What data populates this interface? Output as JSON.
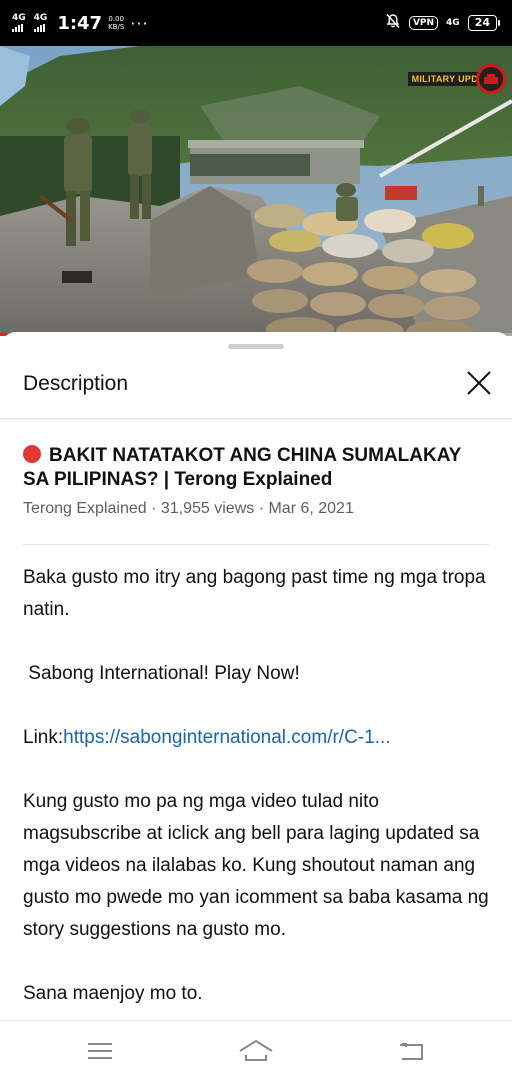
{
  "status_bar": {
    "signal1": "4G",
    "signal2": "4G",
    "time": "1:47",
    "speed_value": "0.00",
    "speed_unit": "KB/S",
    "more": "···",
    "vpn": "VPN",
    "network": "4G",
    "battery": "24"
  },
  "video": {
    "badge_text": "MILITARY UPD",
    "progress_fraction": 0.09,
    "accent_color": "#e62117"
  },
  "sheet": {
    "title": "Description",
    "video_title": "BAKIT NATATAKOT ANG CHINA SUMALAKAY SA PILIPINAS? | Terong Explained",
    "meta": "Terong Explained · 31,955 views · Mar 6, 2021",
    "description": {
      "line1": "Baka gusto mo itry ang bagong past time ng mga tropa natin.",
      "line2": " Sabong International! Play Now!",
      "link_label": "Link:",
      "link_url": "https://sabonginternational.com/r/C-1...",
      "line3": "Kung gusto mo pa ng mga video tulad nito magsubscribe at iclick ang bell para laging updated sa mga videos na ilalabas ko. Kung shoutout naman ang gusto mo pwede mo yan icomment sa baba kasama ng story suggestions na gusto mo.",
      "line4": "Sana maenjoy mo to."
    }
  },
  "icons": {
    "close": "close-icon",
    "menu": "menu-icon",
    "home": "home-icon",
    "back": "back-icon"
  }
}
